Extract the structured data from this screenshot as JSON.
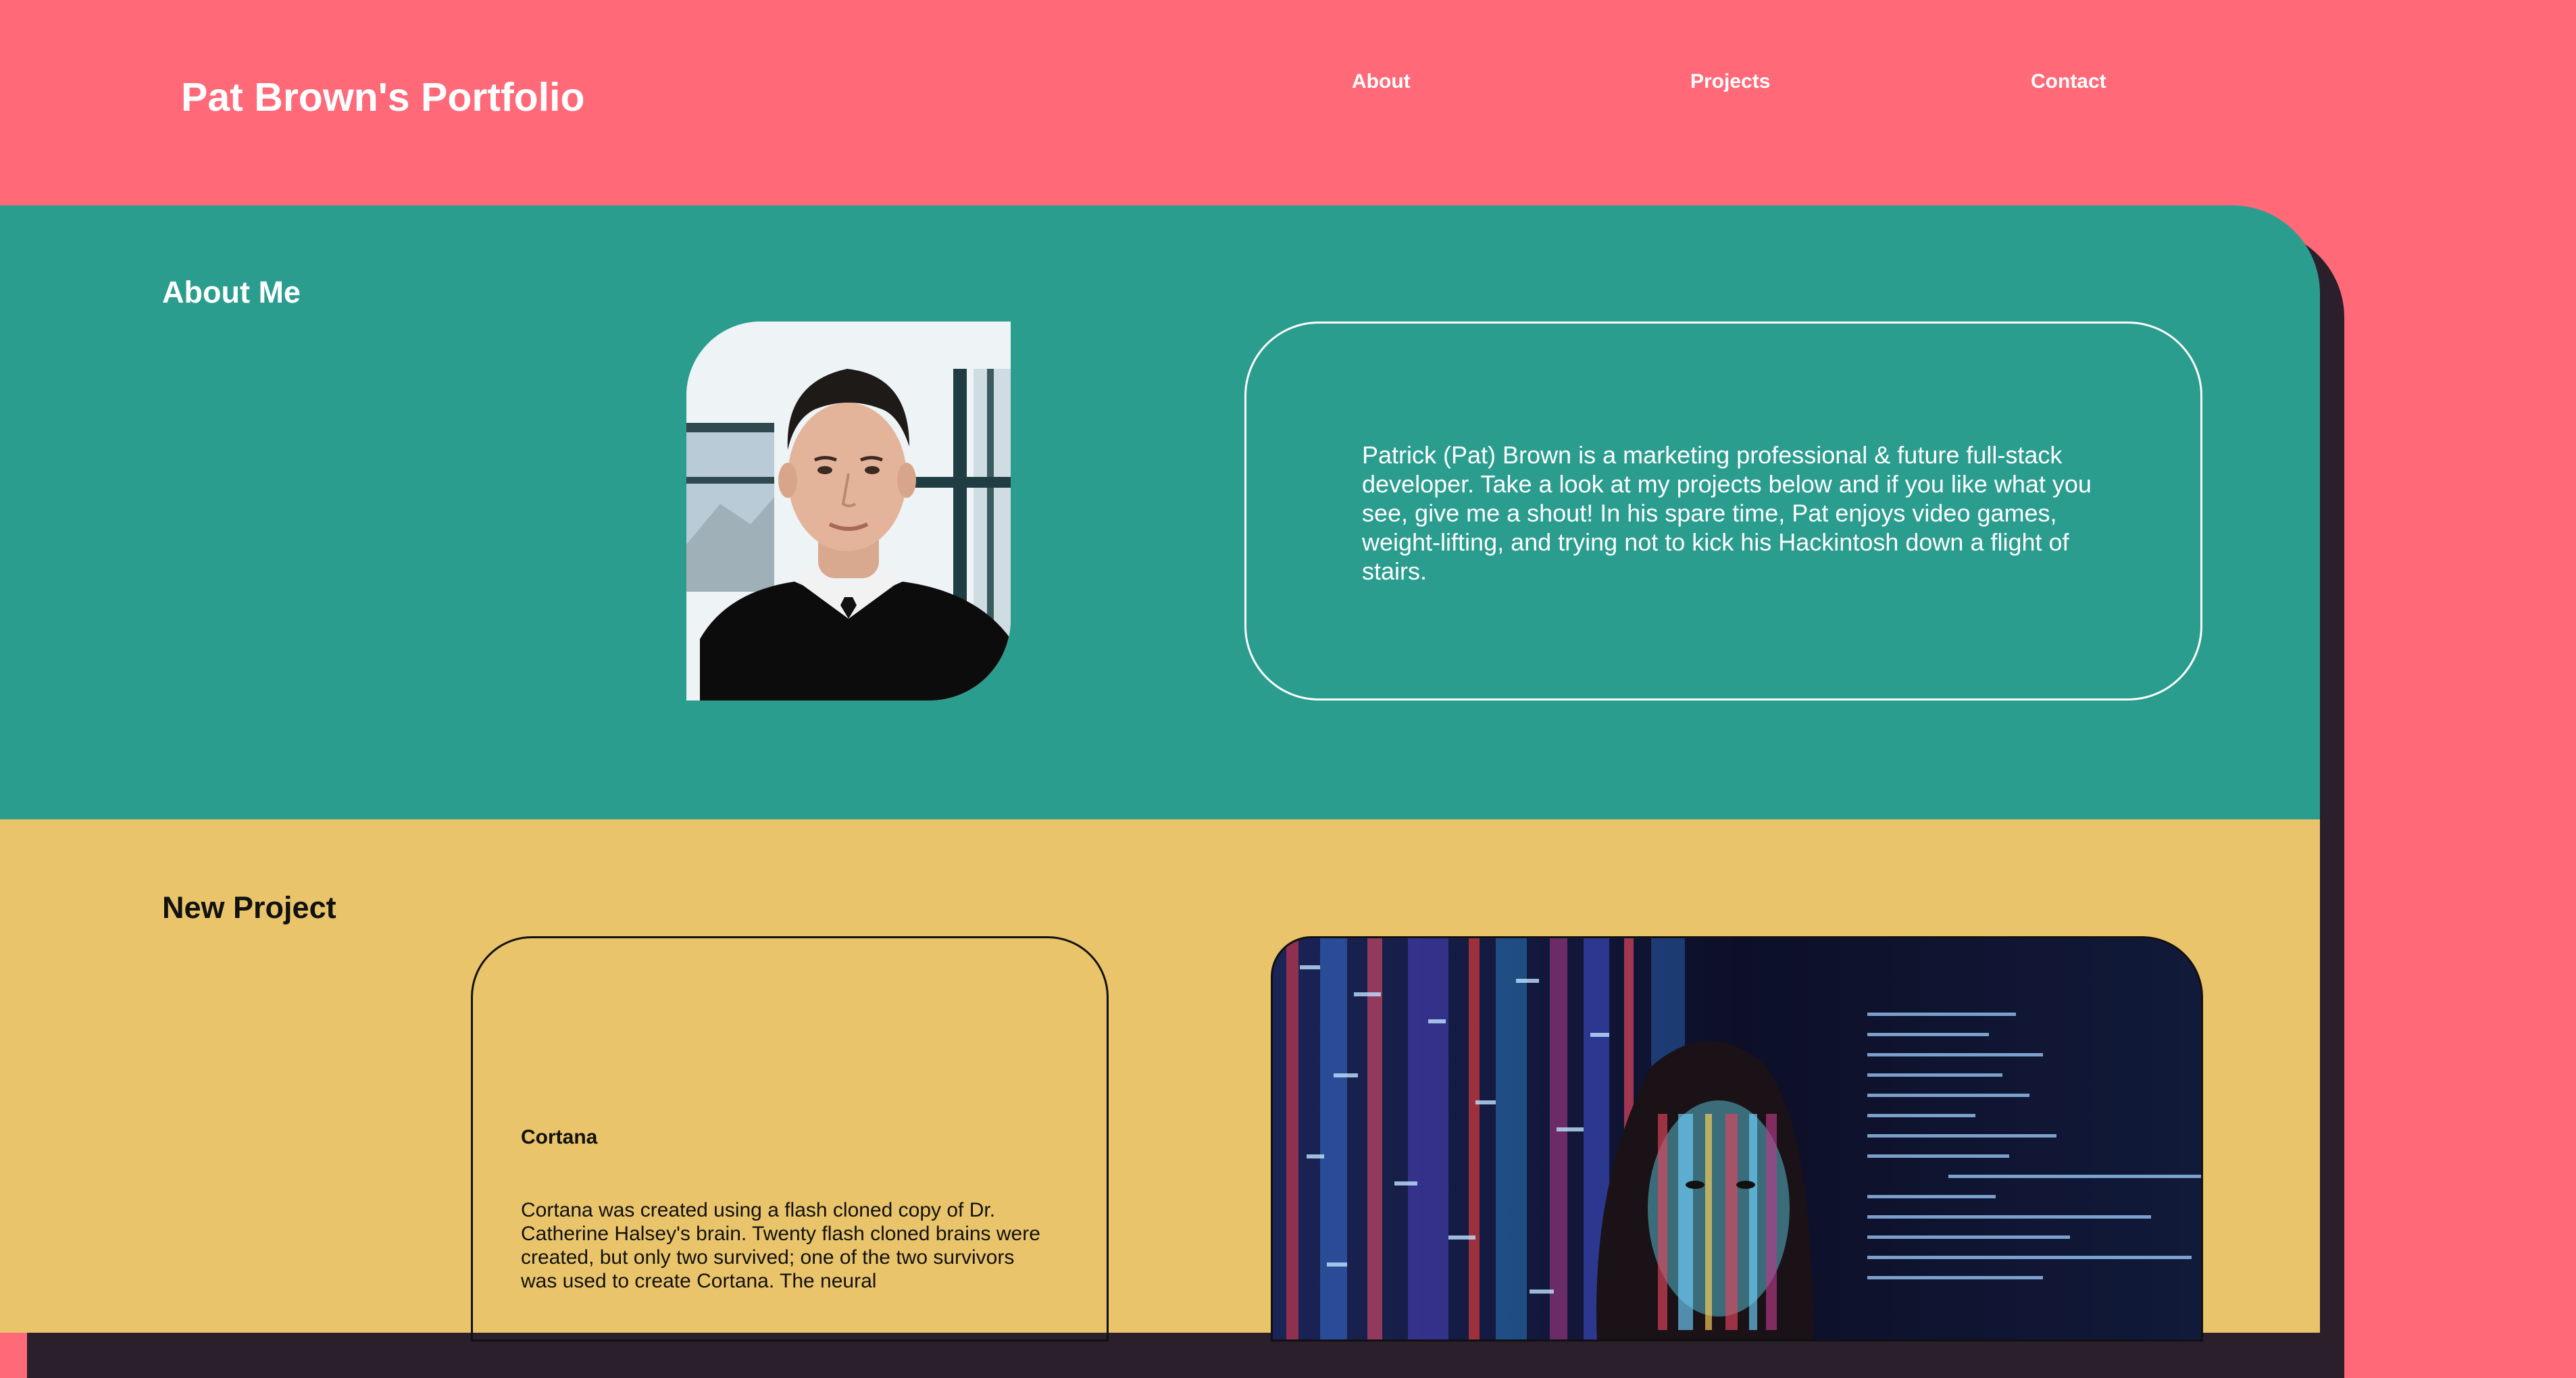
{
  "header": {
    "title": "Pat Brown's Portfolio",
    "nav": [
      {
        "label": "About"
      },
      {
        "label": "Projects"
      },
      {
        "label": "Contact"
      }
    ]
  },
  "about": {
    "heading": "About Me",
    "bio": "Patrick (Pat) Brown is a marketing professional & future full-stack developer. Take a look at my projects below and if you like what you see, give me a shout! In his spare time, Pat enjoys video games, weight-lifting, and trying not to kick his Hackintosh down a flight of stairs."
  },
  "project": {
    "heading": "New Project",
    "name": "Cortana",
    "description": "Cortana was created using a flash cloned copy of Dr. Catherine Halsey's brain. Twenty flash cloned brains were created, but only two survived; one of the two survivors was used to create Cortana. The neural"
  },
  "colors": {
    "header_bg": "#FF6978",
    "about_bg": "#2A9D8F",
    "project_bg": "#E9C46A",
    "text_light": "#FFFFFF",
    "text_dark": "#111111"
  }
}
